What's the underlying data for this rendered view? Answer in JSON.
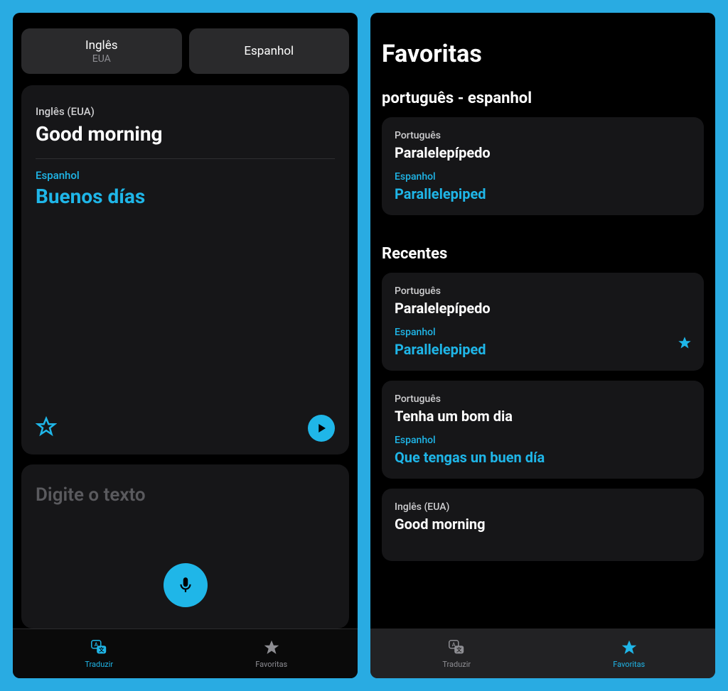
{
  "left": {
    "langPills": {
      "sourceName": "Inglês",
      "sourceRegion": "EUA",
      "targetName": "Espanhol"
    },
    "card": {
      "srcLangLabel": "Inglês (EUA)",
      "srcText": "Good morning",
      "tgtLangLabel": "Espanhol",
      "tgtText": "Buenos días"
    },
    "input": {
      "placeholder": "Digite o texto"
    },
    "tabs": {
      "translate": "Traduzir",
      "favorites": "Favoritas"
    }
  },
  "right": {
    "title": "Favoritas",
    "languagePair": "português - espanhol",
    "favorite": {
      "srcLang": "Português",
      "srcText": "Paralelepípedo",
      "tgtLang": "Espanhol",
      "tgtText": "Parallelepiped"
    },
    "recentsHeading": "Recentes",
    "recents": [
      {
        "srcLang": "Português",
        "srcText": "Paralelepípedo",
        "tgtLang": "Espanhol",
        "tgtText": "Parallelepiped",
        "starred": true
      },
      {
        "srcLang": "Português",
        "srcText": "Tenha um bom dia",
        "tgtLang": "Espanhol",
        "tgtText": "Que tengas un buen día",
        "starred": false
      },
      {
        "srcLang": "Inglês (EUA)",
        "srcText": "Good morning",
        "tgtLang": "",
        "tgtText": "",
        "starred": false
      }
    ],
    "tabs": {
      "translate": "Traduzir",
      "favorites": "Favoritas"
    }
  },
  "colors": {
    "accent": "#1fb6e8",
    "bg": "#29abe2"
  }
}
